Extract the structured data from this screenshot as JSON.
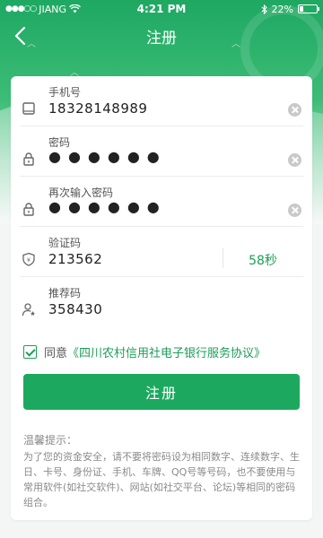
{
  "status_bar": {
    "carrier": "JIANG",
    "time": "4:21 PM",
    "battery": "22%"
  },
  "nav": {
    "title": "注册"
  },
  "form": {
    "phone": {
      "label": "手机号",
      "value": "18328148989",
      "icon": "phone-icon"
    },
    "password": {
      "label": "密码",
      "value": "●●●●●●",
      "icon": "lock-icon"
    },
    "password_confirm": {
      "label": "再次输入密码",
      "value": "●●●●●●",
      "icon": "lock-icon"
    },
    "sms_code": {
      "label": "验证码",
      "value": "213562",
      "countdown": "58秒",
      "icon": "shield-icon"
    },
    "referral": {
      "label": "推荐码",
      "value": "358430",
      "icon": "user-star-icon"
    }
  },
  "agreement": {
    "checked": true,
    "prefix": "同意",
    "link": "《四川农村信用社电子银行服务协议》"
  },
  "submit_label": "注册",
  "tips": {
    "title": "温馨提示：",
    "body": "为了您的资金安全，请不要将密码设为相同数字、连续数字、生日、卡号、身份证、手机、车牌、QQ号等号码，也不要使用与常用软件(如社交软件)、网站(如社交平台、论坛)等相同的密码组合。"
  },
  "colors": {
    "brand_green": "#1ca95f",
    "link_green": "#1a9e57"
  }
}
